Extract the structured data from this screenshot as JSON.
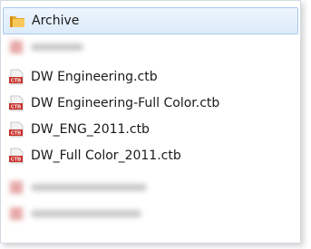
{
  "list": {
    "items": [
      {
        "label": "Archive",
        "icon": "folder-icon",
        "selected": true
      },
      {
        "label": "",
        "icon": "file-icon",
        "blurred": true
      },
      {
        "label": "DW Engineering.ctb",
        "icon": "ctb-file-icon"
      },
      {
        "label": "DW Engineering-Full Color.ctb",
        "icon": "ctb-file-icon"
      },
      {
        "label": "DW_ENG_2011.ctb",
        "icon": "ctb-file-icon"
      },
      {
        "label": "DW_Full Color_2011.ctb",
        "icon": "ctb-file-icon"
      },
      {
        "label": "",
        "icon": "file-icon",
        "blurred": true
      },
      {
        "label": "",
        "icon": "file-icon",
        "blurred": true
      }
    ]
  },
  "colors": {
    "selection_bg": "#dcebfc",
    "selection_border": "#a8c8ef",
    "folder": "#f0b437",
    "ctb_red": "#c8312b"
  }
}
